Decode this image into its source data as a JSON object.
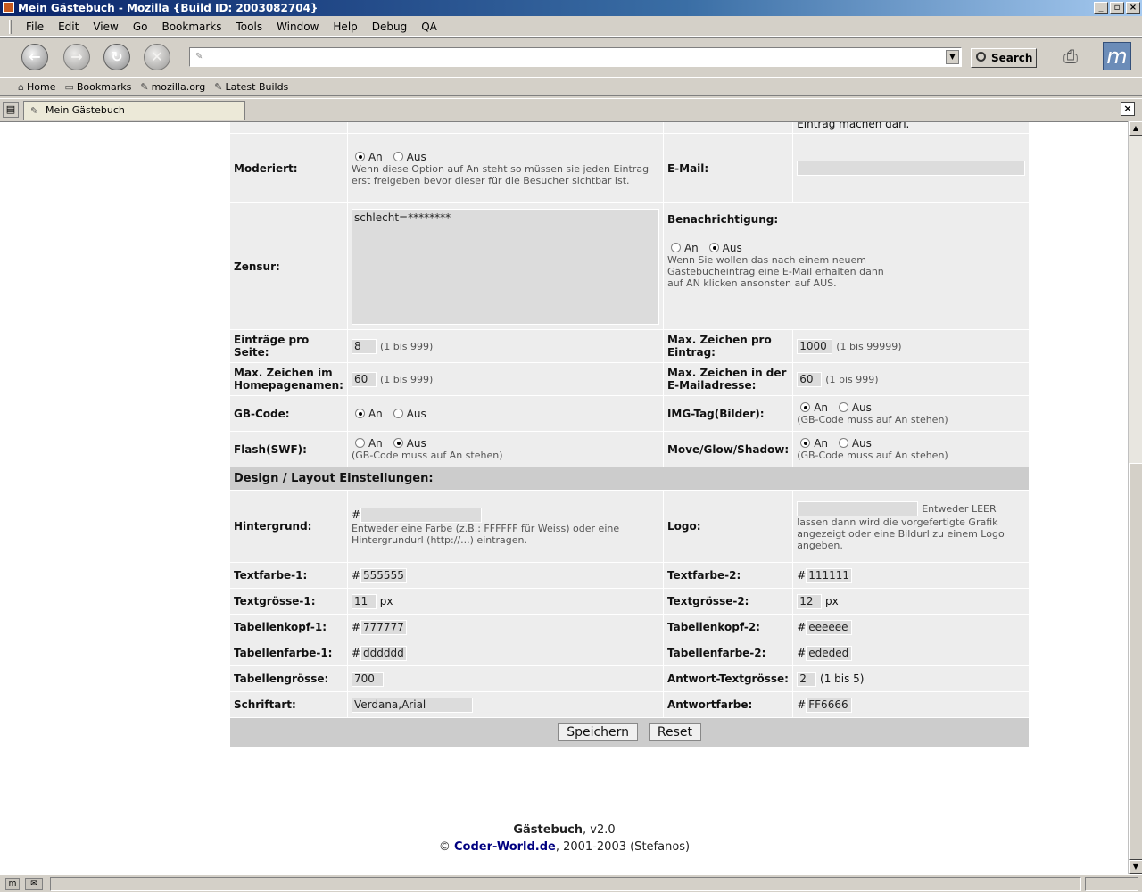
{
  "window": {
    "title": "Mein Gästebuch - Mozilla {Build ID: 2003082704}"
  },
  "menu": [
    "File",
    "Edit",
    "View",
    "Go",
    "Bookmarks",
    "Tools",
    "Window",
    "Help",
    "Debug",
    "QA"
  ],
  "toolbar": {
    "url": "",
    "search_label": "Search"
  },
  "personal_bar": [
    "Home",
    "Bookmarks",
    "mozilla.org",
    "Latest Builds"
  ],
  "tab": {
    "label": "Mein Gästebuch"
  },
  "form": {
    "top_cut_text": "Eintrag machen darf.",
    "moderiert": {
      "label": "Moderiert:",
      "an": "An",
      "aus": "Aus",
      "desc": "Wenn diese Option auf An steht so müssen sie jeden Eintrag erst freigeben bevor dieser für die Besucher sichtbar ist."
    },
    "email": {
      "label": "E-Mail:",
      "value": ""
    },
    "zensur": {
      "label": "Zensur:",
      "value": "schlecht=********"
    },
    "benachrichtigung": {
      "label": "Benachrichtigung:",
      "an": "An",
      "aus": "Aus",
      "desc": "Wenn Sie wollen das nach einem neuem Gästebucheintrag eine E-Mail erhalten dann auf AN klicken ansonsten auf AUS."
    },
    "eintraege": {
      "label": "Einträge pro Seite:",
      "value": "8",
      "hint": "(1 bis 999)"
    },
    "maxzeichen_eintrag": {
      "label": "Max. Zeichen pro Eintrag:",
      "value": "1000",
      "hint": "(1 bis 99999)"
    },
    "maxzeichen_home": {
      "label": "Max. Zeichen im Homepagenamen:",
      "value": "60",
      "hint": "(1 bis 999)"
    },
    "maxzeichen_mail": {
      "label": "Max. Zeichen in der E-Mailadresse:",
      "value": "60",
      "hint": "(1 bis 999)"
    },
    "gbcode": {
      "label": "GB-Code:",
      "an": "An",
      "aus": "Aus"
    },
    "imgtag": {
      "label": "IMG-Tag(Bilder):",
      "an": "An",
      "aus": "Aus",
      "note": "(GB-Code muss auf An stehen)"
    },
    "flash": {
      "label": "Flash(SWF):",
      "an": "An",
      "aus": "Aus",
      "note": "(GB-Code muss auf An stehen)"
    },
    "moveglow": {
      "label": "Move/Glow/Shadow:",
      "an": "An",
      "aus": "Aus",
      "note": "(GB-Code muss auf An stehen)"
    },
    "design_heading": "Design / Layout Einstellungen:",
    "hintergrund": {
      "label": "Hintergrund:",
      "hash": "#",
      "value": "",
      "desc": "Entweder eine Farbe (z.B.: FFFFFF für Weiss) oder eine Hintergrundurl (http://...) eintragen."
    },
    "logo": {
      "label": "Logo:",
      "value": "",
      "desc_a": "Entweder LEER",
      "desc_b": "lassen dann wird die vorgefertigte Grafik angezeigt oder eine Bildurl zu einem Logo angeben."
    },
    "textfarbe1": {
      "label": "Textfarbe-1:",
      "hash": "#",
      "value": "555555"
    },
    "textfarbe2": {
      "label": "Textfarbe-2:",
      "hash": "#",
      "value": "111111"
    },
    "textgroesse1": {
      "label": "Textgrösse-1:",
      "value": "11",
      "unit": "px"
    },
    "textgroesse2": {
      "label": "Textgrösse-2:",
      "value": "12",
      "unit": "px"
    },
    "tabkopf1": {
      "label": "Tabellenkopf-1:",
      "hash": "#",
      "value": "777777"
    },
    "tabkopf2": {
      "label": "Tabellenkopf-2:",
      "hash": "#",
      "value": "eeeeee"
    },
    "tabfarbe1": {
      "label": "Tabellenfarbe-1:",
      "hash": "#",
      "value": "dddddd"
    },
    "tabfarbe2": {
      "label": "Tabellenfarbe-2:",
      "hash": "#",
      "value": "ededed"
    },
    "tabgroesse": {
      "label": "Tabellengrösse:",
      "value": "700"
    },
    "antwortgroesse": {
      "label": "Antwort-Textgrösse:",
      "value": "2",
      "hint": "(1 bis 5)"
    },
    "schriftart": {
      "label": "Schriftart:",
      "value": "Verdana,Arial"
    },
    "antwortfarbe": {
      "label": "Antwortfarbe:",
      "hash": "#",
      "value": "FF6666"
    },
    "save_label": "Speichern",
    "reset_label": "Reset"
  },
  "footer": {
    "app": "Gästebuch",
    "version": ", v2.0",
    "copy": "©",
    "link": "Coder-World.de",
    "years": ", 2001-2003 (Stefanos)"
  }
}
